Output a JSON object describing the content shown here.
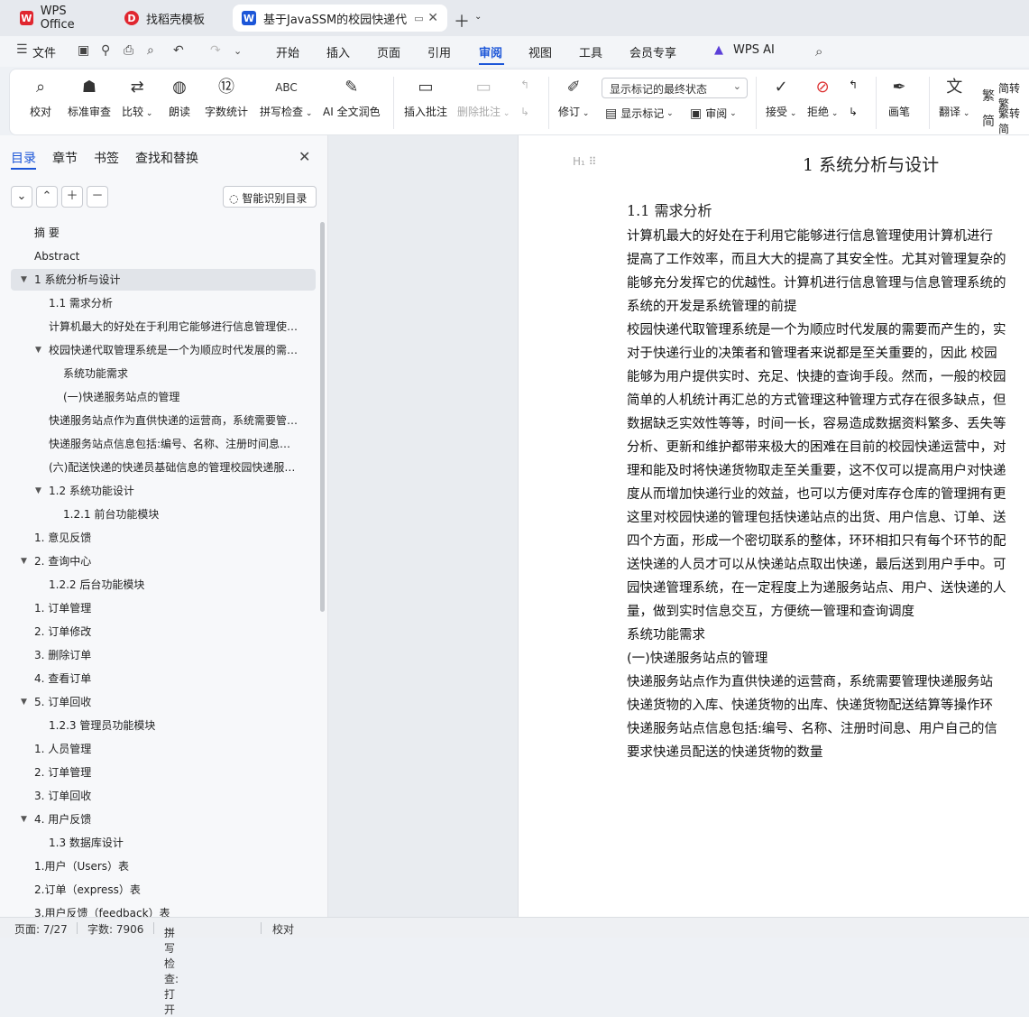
{
  "tabs": [
    {
      "label": "WPS Office",
      "logo": "W"
    },
    {
      "label": "找稻壳模板",
      "logo": "D"
    },
    {
      "label": "基于JavaSSM的校园快递代",
      "logo": "W"
    }
  ],
  "menu": {
    "file": "文件",
    "items": [
      "开始",
      "插入",
      "页面",
      "引用",
      "审阅",
      "视图",
      "工具",
      "会员专享"
    ],
    "active": "审阅",
    "wps_ai": "WPS AI"
  },
  "ribbon": {
    "proofread": "校对",
    "std_review": "标准审查",
    "compare": "比较",
    "read_aloud": "朗读",
    "word_count": "字数统计",
    "spell_check": "拼写检查",
    "ai_polish": "AI 全文润色",
    "insert_comment": "插入批注",
    "delete_comment": "删除批注",
    "revise": "修订",
    "show_markup_select": "显示标记的最终状态",
    "show_markup": "显示标记",
    "review": "审阅",
    "accept": "接受",
    "reject": "拒绝",
    "pen": "画笔",
    "translate": "翻译",
    "to_traditional": "简转繁",
    "to_simplified": "繁转简"
  },
  "sidebar": {
    "tabs": [
      "目录",
      "章节",
      "书签",
      "查找和替换"
    ],
    "smart_btn": "智能识别目录",
    "toc": [
      {
        "label": "摘  要",
        "indent": 0,
        "tri": false
      },
      {
        "label": "Abstract",
        "indent": 0,
        "tri": false
      },
      {
        "label": "1   系统分析与设计",
        "indent": 0,
        "tri": true,
        "sel": true
      },
      {
        "label": "1.1  需求分析",
        "indent": 1,
        "tri": false
      },
      {
        "label": "计算机最大的好处在于利用它能够进行信息管理使用 ...",
        "indent": 1,
        "tri": false
      },
      {
        "label": "校园快递代取管理系统是一个为顺应时代发展的需要 ...",
        "indent": 1,
        "tri": true
      },
      {
        "label": "系统功能需求",
        "indent": 2,
        "tri": false
      },
      {
        "label": "(一)快递服务站点的管理",
        "indent": 2,
        "tri": false
      },
      {
        "label": "快递服务站点作为直供快递的运营商，系统需要管理 ...",
        "indent": 1,
        "tri": false
      },
      {
        "label": "快递服务站点信息包括:编号、名称、注册时间息、 ...",
        "indent": 1,
        "tri": false
      },
      {
        "label": "(六)配送快递的快递员基础信息的管理校园快递服务 ...",
        "indent": 1,
        "tri": false
      },
      {
        "label": "1.2  系统功能设计",
        "indent": 1,
        "tri": true
      },
      {
        "label": "1.2.1  前台功能模块",
        "indent": 2,
        "tri": false
      },
      {
        "label": "1. 意见反馈",
        "indent": 0,
        "tri": false
      },
      {
        "label": "2. 查询中心",
        "indent": 0,
        "tri": true
      },
      {
        "label": "1.2.2  后台功能模块",
        "indent": 1,
        "tri": false
      },
      {
        "label": "1. 订单管理",
        "indent": 0,
        "tri": false
      },
      {
        "label": "2. 订单修改",
        "indent": 0,
        "tri": false
      },
      {
        "label": "3. 删除订单",
        "indent": 0,
        "tri": false
      },
      {
        "label": "4. 查看订单",
        "indent": 0,
        "tri": false
      },
      {
        "label": "5. 订单回收",
        "indent": 0,
        "tri": true
      },
      {
        "label": "1.2.3  管理员功能模块",
        "indent": 1,
        "tri": false
      },
      {
        "label": "1. 人员管理",
        "indent": 0,
        "tri": false
      },
      {
        "label": "2. 订单管理",
        "indent": 0,
        "tri": false
      },
      {
        "label": "3. 订单回收",
        "indent": 0,
        "tri": false
      },
      {
        "label": "4. 用户反馈",
        "indent": 0,
        "tri": true
      },
      {
        "label": "1.3 数据库设计",
        "indent": 1,
        "tri": false
      },
      {
        "label": "1.用户（Users）表",
        "indent": 0,
        "tri": false
      },
      {
        "label": "2.订单（express）表",
        "indent": 0,
        "tri": false
      },
      {
        "label": "3.用户反馈（feedback）表",
        "indent": 0,
        "tri": false
      }
    ]
  },
  "document": {
    "heading_marker": "H₁",
    "title": "1   系统分析与设计",
    "subtitle": "1.1  需求分析",
    "lines": [
      "计算机最大的好处在于利用它能够进行信息管理使用计算机进行",
      "提高了工作效率，而且大大的提高了其安全性。尤其对管理复杂的",
      "能够充分发挥它的优越性。计算机进行信息管理与信息管理系统的",
      "系统的开发是系统管理的前提",
      "校园快递代取管理系统是一个为顺应时代发展的需要而产生的，实",
      "对于快递行业的决策者和管理者来说都是至关重要的，因此  校园",
      "能够为用户提供实时、充足、快捷的查询手段。然而，一般的校园",
      "简单的人机统计再汇总的方式管理这种管理方式存在很多缺点，但",
      "数据缺乏实效性等等，时间一长，容易造成数据资料繁多、丢失等",
      "分析、更新和维护都带来极大的困难在目前的校园快递运营中，对",
      "理和能及时将快递货物取走至关重要，这不仅可以提高用户对快递",
      "度从而增加快递行业的效益，也可以方便对库存仓库的管理拥有更",
      "这里对校园快递的管理包括快递站点的出货、用户信息、订单、送",
      "四个方面，形成一个密切联系的整体，环环相扣只有每个环节的配",
      "送快递的人员才可以从快递站点取出快递，最后送到用户手中。可",
      "园快递管理系统，在一定程度上为递服务站点、用户、送快递的人",
      "量，做到实时信息交互，方便统一管理和查询调度",
      "系统功能需求",
      "(一)快递服务站点的管理",
      "快递服务站点作为直供快递的运营商，系统需要管理快递服务站",
      "快递货物的入库、快递货物的出库、快递货物配送结算等操作环",
      "快递服务站点信息包括:编号、名称、注册时间息、用户自己的信",
      "要求快递员配送的快递货物的数量"
    ]
  },
  "status": {
    "page": "页面: 7/27",
    "words": "字数: 7906",
    "spell": "拼写检查: 打开",
    "proof": "校对"
  },
  "colors": {
    "accent": "#1c56d8",
    "wps_red": "#e0262f"
  }
}
